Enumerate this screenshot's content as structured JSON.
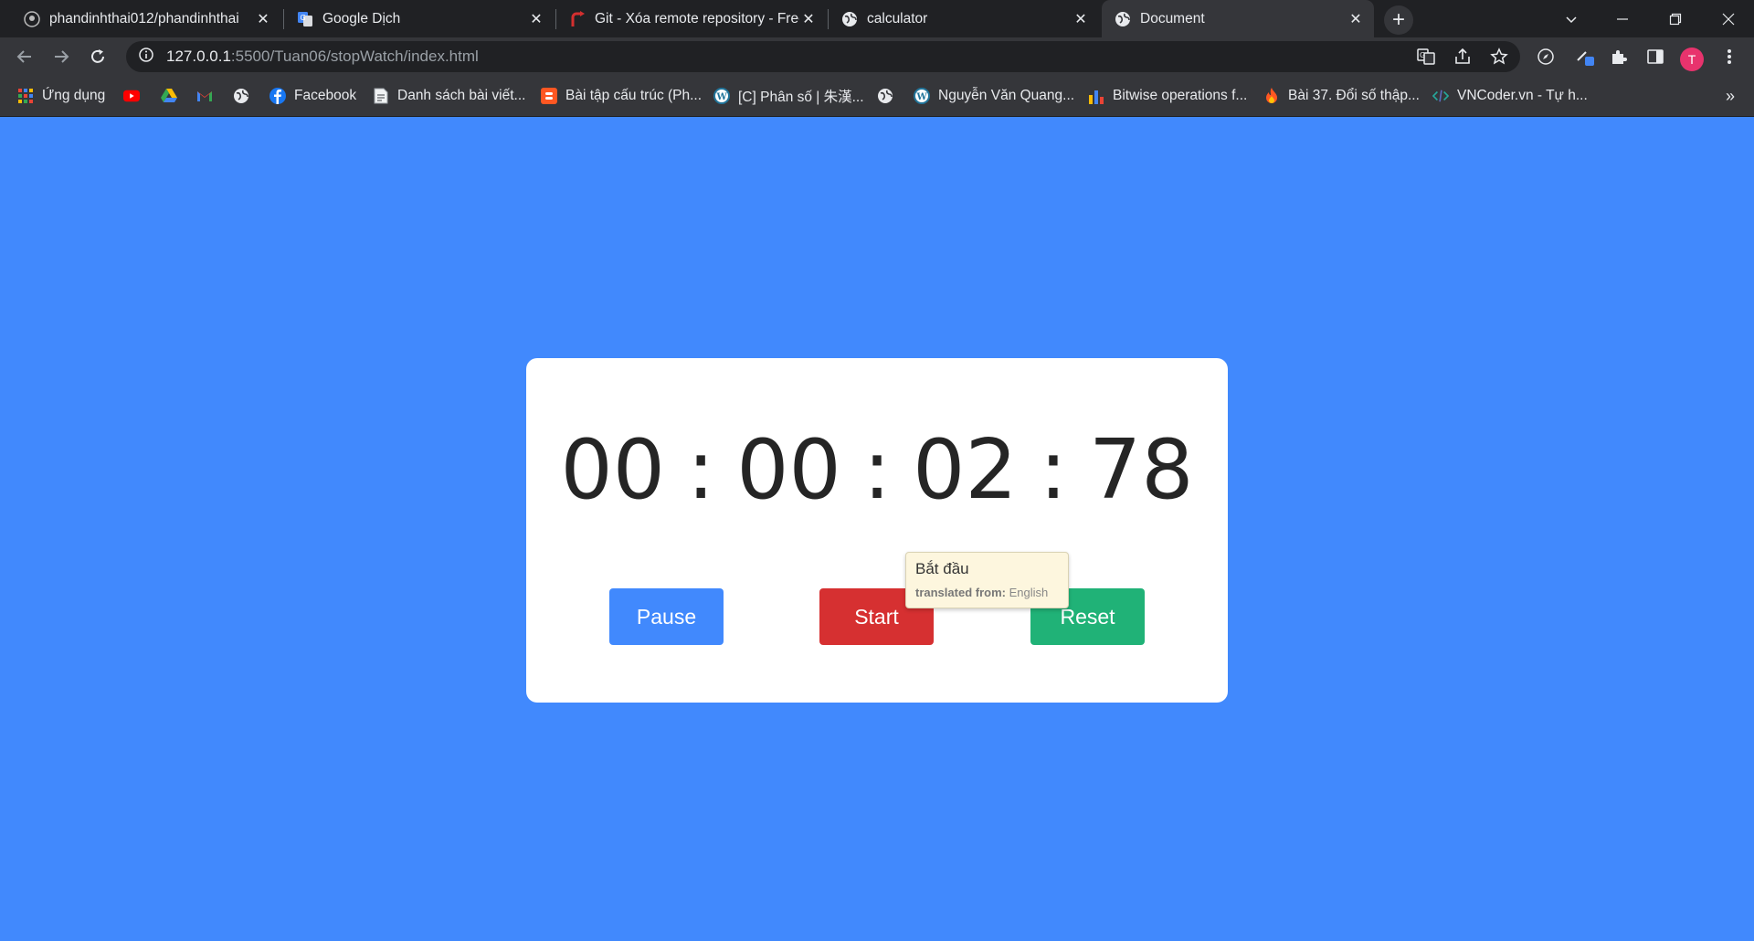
{
  "tabs": [
    {
      "title": "phandinhthai012/phandinhthai",
      "icon": "github-icon"
    },
    {
      "title": "Google Dịch",
      "icon": "google-translate-icon"
    },
    {
      "title": "Git - Xóa remote repository - Freetuts",
      "icon": "freetuts-icon"
    },
    {
      "title": "calculator",
      "icon": "globe-icon"
    },
    {
      "title": "Document",
      "icon": "globe-icon",
      "active": true
    }
  ],
  "address_bar": {
    "host": "127.0.0.1",
    "path": ":5500/Tuan06/stopWatch/index.html"
  },
  "profile_initial": "T",
  "bookmarks": [
    {
      "label": "Ứng dụng",
      "icon": "apps-grid-icon"
    },
    {
      "label": "",
      "icon": "youtube-icon"
    },
    {
      "label": "",
      "icon": "google-drive-icon"
    },
    {
      "label": "",
      "icon": "gmail-icon"
    },
    {
      "label": "",
      "icon": "globe-icon"
    },
    {
      "label": "Facebook",
      "icon": "facebook-icon"
    },
    {
      "label": "Danh sách bài viết...",
      "icon": "document-icon"
    },
    {
      "label": "Bài tập cấu trúc (Ph...",
      "icon": "blogger-icon"
    },
    {
      "label": "[C] Phân số | 朱漢...",
      "icon": "wordpress-icon"
    },
    {
      "label": "",
      "icon": "globe-icon"
    },
    {
      "label": "Nguyễn Văn Quang...",
      "icon": "wordpress-icon"
    },
    {
      "label": "Bitwise operations f...",
      "icon": "bar-chart-icon"
    },
    {
      "label": "Bài 37. Đổi số thập...",
      "icon": "fire-icon"
    },
    {
      "label": "VNCoder.vn - Tự h...",
      "icon": "code-icon"
    }
  ],
  "stopwatch": {
    "hours": "00",
    "minutes": "00",
    "seconds": "02",
    "centiseconds": "78",
    "separator": ":",
    "pause_label": "Pause",
    "start_label": "Start",
    "reset_label": "Reset"
  },
  "tooltip": {
    "translation": "Bắt đầu",
    "from_label": "translated from:",
    "from_language": "English"
  },
  "colors": {
    "page_bg": "#4189fd",
    "pause": "#4189fd",
    "start": "#d63031",
    "reset": "#20b277"
  }
}
